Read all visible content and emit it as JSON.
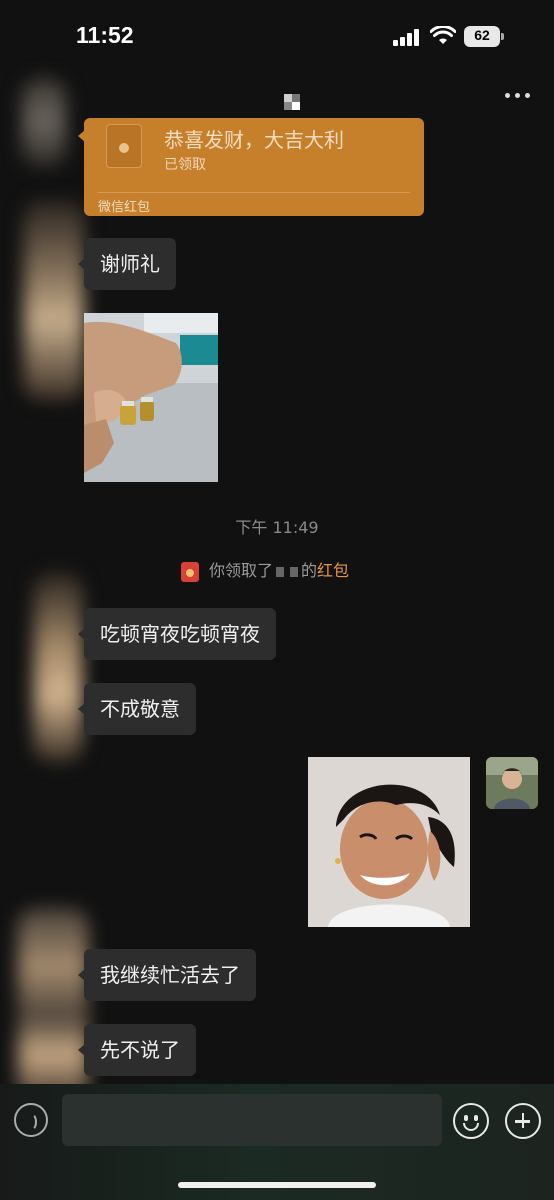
{
  "status_bar": {
    "time": "11:52",
    "battery": "62",
    "icons": [
      "signal-icon",
      "wifi-icon",
      "battery-icon"
    ]
  },
  "header": {
    "more_icon": "more-icon"
  },
  "messages": {
    "red_packet": {
      "title": "恭喜发财，大吉大利",
      "status": "已领取",
      "source": "微信红包"
    },
    "m1": "谢师礼",
    "timestamp": "下午 11:49",
    "notice": {
      "prefix": "你领取了",
      "middle": "的",
      "link": "红包"
    },
    "m2": "吃顿宵夜吃顿宵夜",
    "m3": "不成敬意",
    "m4": "我继续忙活去了",
    "m5": "先不说了"
  },
  "input_bar": {
    "value": "",
    "icons": [
      "voice-icon",
      "emoji-icon",
      "plus-icon"
    ]
  },
  "colors": {
    "background": "#111111",
    "bubble": "#2d2d2d",
    "red_packet": "#c6802c",
    "link": "#e79443"
  }
}
